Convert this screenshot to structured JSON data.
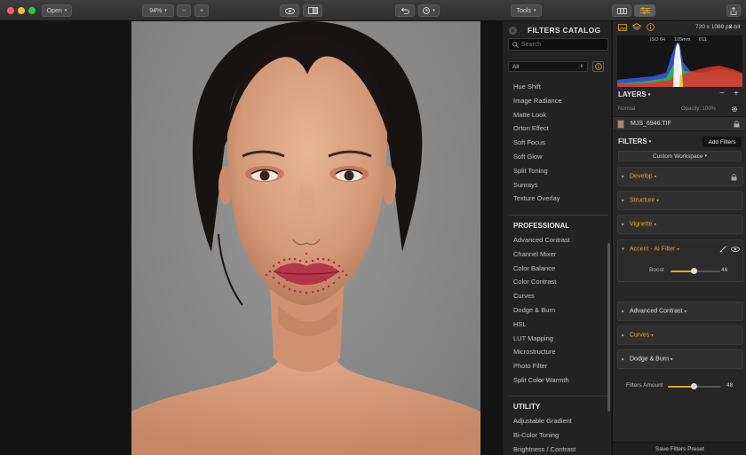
{
  "toolbar": {
    "open_label": "Open",
    "zoom_value": "94%",
    "zoom_out_label": "−",
    "zoom_in_label": "+",
    "tools_label": "Tools"
  },
  "catalog": {
    "title": "FILTERS CATALOG",
    "search_placeholder": "Search",
    "category_value": "All",
    "items_top": [
      "Hue Shift",
      "Image Radiance",
      "Matte Look",
      "Orton Effect",
      "Soft Focus",
      "Soft Glow",
      "Split Toning",
      "Sunrays",
      "Texture Overlay"
    ],
    "section_professional": "PROFESSIONAL",
    "items_professional": [
      "Advanced Contrast",
      "Channel Mixer",
      "Color Balance",
      "Color Contrast",
      "Curves",
      "Dodge & Burn",
      "HSL",
      "LUT Mapping",
      "Microstructure",
      "Photo Filter",
      "Split Color Warmth"
    ],
    "section_utility": "UTILITY",
    "items_utility": [
      "Adjustable Gradient",
      "Bi-Color Toning",
      "Brightness / Contrast"
    ]
  },
  "info": {
    "dimensions": "720 x 1080 px",
    "bit_depth": "8-bit",
    "iso": "ISO 64",
    "focal": "105mm",
    "aperture": "f/11"
  },
  "histogram_colors": {
    "red": "#e03030",
    "green": "#30c040",
    "blue": "#3a5ae8",
    "white": "#f0f0f0",
    "yellow": "#e0d030"
  },
  "layers": {
    "title": "LAYERS",
    "blend_mode": "Normal",
    "opacity_label": "Opacity: 100%",
    "layer_name": "MJS_6946.TIF"
  },
  "filters": {
    "title": "FILTERS",
    "add_button": "Add Filters",
    "workspace": "Custom Workspace",
    "develop": "Develop",
    "structure": "Structure",
    "vignette": "Vignette",
    "accent": "Accent - AI Filter",
    "boost_label": "Boost",
    "boost_value": "46",
    "boost_fraction": 0.46,
    "advanced_contrast": "Advanced Contrast",
    "curves": "Curves",
    "dodge_burn": "Dodge & Burn",
    "amount_label": "Filters Amount",
    "amount_value": "48",
    "amount_fraction": 0.48,
    "save_preset": "Save Filters Preset"
  },
  "accent_color": "#e2a52b"
}
